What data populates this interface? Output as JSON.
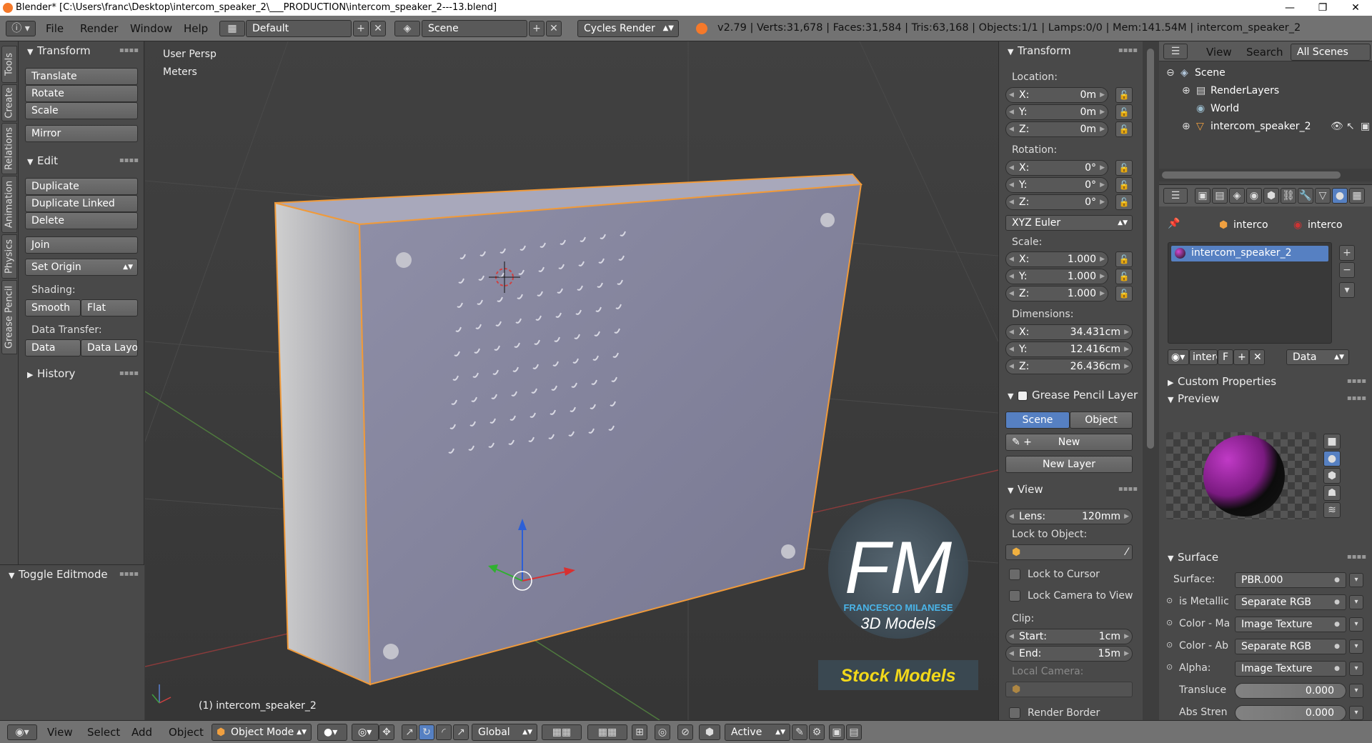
{
  "window": {
    "title": "Blender* [C:\\Users\\franc\\Desktop\\intercom_speaker_2\\___PRODUCTION\\intercom_speaker_2---13.blend]"
  },
  "menu": {
    "file": "File",
    "render": "Render",
    "window": "Window",
    "help": "Help"
  },
  "header": {
    "layout": "Default",
    "scene": "Scene",
    "engine": "Cycles Render",
    "stats": "v2.79 | Verts:31,678 | Faces:31,584 | Tris:63,168 | Objects:1/1 | Lamps:0/0 | Mem:141.54M | intercom_speaker_2"
  },
  "left_tabs": [
    "Tools",
    "Create",
    "Relations",
    "Animation",
    "Physics",
    "Grease Pencil"
  ],
  "tool_shelf": {
    "transform": {
      "title": "Transform",
      "translate": "Translate",
      "rotate": "Rotate",
      "scale": "Scale",
      "mirror": "Mirror"
    },
    "edit": {
      "title": "Edit",
      "duplicate": "Duplicate",
      "duplicate_linked": "Duplicate Linked",
      "delete": "Delete",
      "join": "Join",
      "set_origin": "Set Origin",
      "shading_label": "Shading:",
      "smooth": "Smooth",
      "flat": "Flat",
      "data_transfer_label": "Data Transfer:",
      "data": "Data",
      "data_layout": "Data Layo"
    },
    "history": "History",
    "toggle_editmode": "Toggle Editmode"
  },
  "viewport": {
    "view_name": "User Persp",
    "units": "Meters",
    "object_label": "(1) intercom_speaker_2",
    "watermark_initials": "FM",
    "watermark_name": "FRANCESCO MILANESE",
    "watermark_sub": "3D Models",
    "watermark_banner": "Stock Models"
  },
  "n_panel": {
    "transform_title": "Transform",
    "location_label": "Location:",
    "loc": [
      {
        "k": "X:",
        "v": "0m"
      },
      {
        "k": "Y:",
        "v": "0m"
      },
      {
        "k": "Z:",
        "v": "0m"
      }
    ],
    "rotation_label": "Rotation:",
    "rot": [
      {
        "k": "X:",
        "v": "0°"
      },
      {
        "k": "Y:",
        "v": "0°"
      },
      {
        "k": "Z:",
        "v": "0°"
      }
    ],
    "rot_mode": "XYZ Euler",
    "scale_label": "Scale:",
    "scl": [
      {
        "k": "X:",
        "v": "1.000"
      },
      {
        "k": "Y:",
        "v": "1.000"
      },
      {
        "k": "Z:",
        "v": "1.000"
      }
    ],
    "dimensions_label": "Dimensions:",
    "dim": [
      {
        "k": "X:",
        "v": "34.431cm"
      },
      {
        "k": "Y:",
        "v": "12.416cm"
      },
      {
        "k": "Z:",
        "v": "26.436cm"
      }
    ],
    "grease_title": "Grease Pencil Layer",
    "scene_tab": "Scene",
    "object_tab": "Object",
    "new": "New",
    "new_layer": "New Layer",
    "view_title": "View",
    "lens_k": "Lens:",
    "lens_v": "120mm",
    "lock_to_object": "Lock to Object:",
    "lock_cursor": "Lock to Cursor",
    "lock_camera": "Lock Camera to View",
    "clip_label": "Clip:",
    "clip_start_k": "Start:",
    "clip_start_v": "1cm",
    "clip_end_k": "End:",
    "clip_end_v": "15m",
    "local_camera": "Local Camera:",
    "render_border": "Render Border"
  },
  "outliner": {
    "view": "View",
    "search": "Search",
    "filter": "All Scenes",
    "scene": "Scene",
    "renderlayers": "RenderLayers",
    "world": "World",
    "object": "intercom_speaker_2"
  },
  "properties": {
    "bc1": "interco",
    "bc2": "interco",
    "material_slot": "intercom_speaker_2",
    "mat_name": "interc",
    "f": "F",
    "link": "Data",
    "custom_props": "Custom Properties",
    "preview": "Preview",
    "surface_title": "Surface",
    "rows": [
      {
        "k": "Surface:",
        "v": "PBR.000"
      },
      {
        "k": "is Metallic",
        "v": "Separate RGB"
      },
      {
        "k": "Color - Ma",
        "v": "Image Texture"
      },
      {
        "k": "Color - Ab",
        "v": "Separate RGB"
      },
      {
        "k": "Alpha:",
        "v": "Image Texture"
      },
      {
        "k": "Transluce",
        "v": "0.000"
      },
      {
        "k": "Abs Stren",
        "v": "0.000"
      }
    ]
  },
  "bottom": {
    "view": "View",
    "select": "Select",
    "add": "Add",
    "object": "Object",
    "mode": "Object Mode",
    "orientation": "Global",
    "pivot": "Active"
  },
  "colors": {
    "accent": "#5680c2",
    "orange": "#f5792a",
    "watermark_blue": "#4ab4e8",
    "banner_yellow": "#f2d81a"
  }
}
